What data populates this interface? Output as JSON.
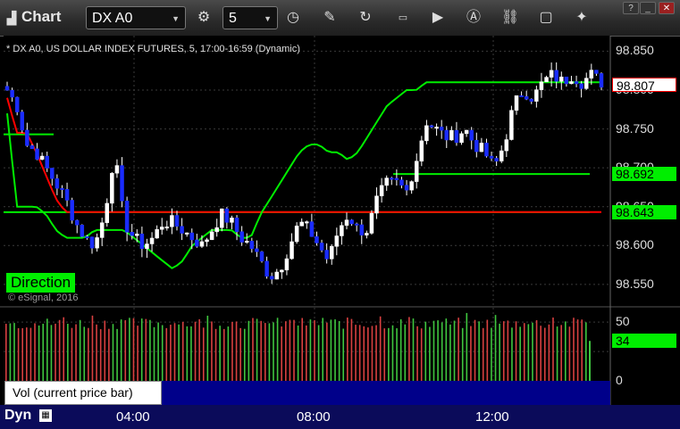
{
  "toolbar": {
    "title": "Chart",
    "symbol": "DX A0",
    "interval": "5"
  },
  "chart_title": "* DX A0, US DOLLAR INDEX FUTURES, 5, 17:00-16:59 (Dynamic)",
  "copyright": "© eSignal, 2016",
  "badge": "Direction",
  "legend_label": "Vol (current price bar)",
  "dyn": "Dyn",
  "colors": {
    "up": "#ffffff",
    "down": "#1a2cff",
    "red_line": "#ff0000",
    "green_line": "#00ee00",
    "vol_up": "#3fc63f",
    "vol_down": "#d84040"
  },
  "chart_data": {
    "type": "candlestick",
    "price_axis": {
      "range": [
        98.52,
        98.87
      ],
      "ticks": [
        "98.850",
        "98.800",
        "98.750",
        "98.700",
        "98.650",
        "98.600",
        "98.550"
      ]
    },
    "price_labels": [
      {
        "value": "98.807",
        "kind": "last"
      },
      {
        "value": "98.692",
        "kind": "level"
      },
      {
        "value": "98.643",
        "kind": "level"
      }
    ],
    "volume_axis": {
      "range": [
        0,
        60
      ],
      "ticks": [
        "50",
        "0"
      ]
    },
    "volume_label": "34",
    "x_ticks": [
      "04:00",
      "08:00",
      "12:00"
    ],
    "horizontal_levels": [
      98.743,
      98.692,
      98.643
    ],
    "close_anchors": [
      98.8,
      98.78,
      98.73,
      98.72,
      98.7,
      98.68,
      98.66,
      98.63,
      98.61,
      98.6,
      98.64,
      98.72,
      98.63,
      98.61,
      98.6,
      98.61,
      98.63,
      98.63,
      98.62,
      98.61,
      98.6,
      98.62,
      98.64,
      98.63,
      98.61,
      98.6,
      98.58,
      98.56,
      98.57,
      98.6,
      98.63,
      98.62,
      98.6,
      98.58,
      98.62,
      98.64,
      98.62,
      98.62,
      98.66,
      98.68,
      98.68,
      98.67,
      98.71,
      98.76,
      98.75,
      98.74,
      98.74,
      98.75,
      98.73,
      98.72,
      98.7,
      98.73,
      98.78,
      98.8,
      98.79,
      98.81,
      98.82,
      98.81,
      98.82,
      98.81,
      98.82,
      98.81
    ],
    "red_anchors": [
      98.79,
      98.745,
      98.745,
      98.72,
      98.69,
      98.66,
      98.643,
      98.643,
      98.643,
      98.643,
      98.643,
      98.643,
      98.643,
      98.643,
      98.643,
      98.643,
      98.643,
      98.643,
      98.643,
      98.643,
      98.643,
      98.643,
      98.643,
      98.643,
      98.643,
      98.643,
      98.643,
      98.643,
      98.643,
      98.643,
      98.643,
      98.643,
      98.643,
      98.643,
      98.643,
      98.643,
      98.643,
      98.643,
      98.643,
      98.643,
      98.643,
      98.643,
      98.643,
      98.643,
      98.643,
      98.643,
      98.643,
      98.643,
      98.643,
      98.643,
      98.643,
      98.643,
      98.643,
      98.643,
      98.643,
      98.643,
      98.643,
      98.643,
      98.643,
      98.643,
      98.643,
      98.643
    ],
    "green_anchors": [
      98.77,
      98.65,
      98.65,
      98.65,
      98.64,
      98.62,
      98.61,
      98.61,
      98.61,
      98.62,
      98.62,
      98.62,
      98.62,
      98.61,
      98.6,
      98.59,
      98.58,
      98.57,
      98.58,
      98.6,
      98.61,
      98.62,
      98.62,
      98.62,
      98.61,
      98.61,
      98.64,
      98.66,
      98.68,
      98.7,
      98.72,
      98.73,
      98.73,
      98.72,
      98.72,
      98.71,
      98.72,
      98.74,
      98.76,
      98.78,
      98.79,
      98.8,
      98.8,
      98.81,
      98.81,
      98.81,
      98.81,
      98.81,
      98.81,
      98.81,
      98.81,
      98.81,
      98.81,
      98.81,
      98.81,
      98.81,
      98.81,
      98.81,
      98.81,
      98.81,
      98.81,
      98.81
    ]
  }
}
